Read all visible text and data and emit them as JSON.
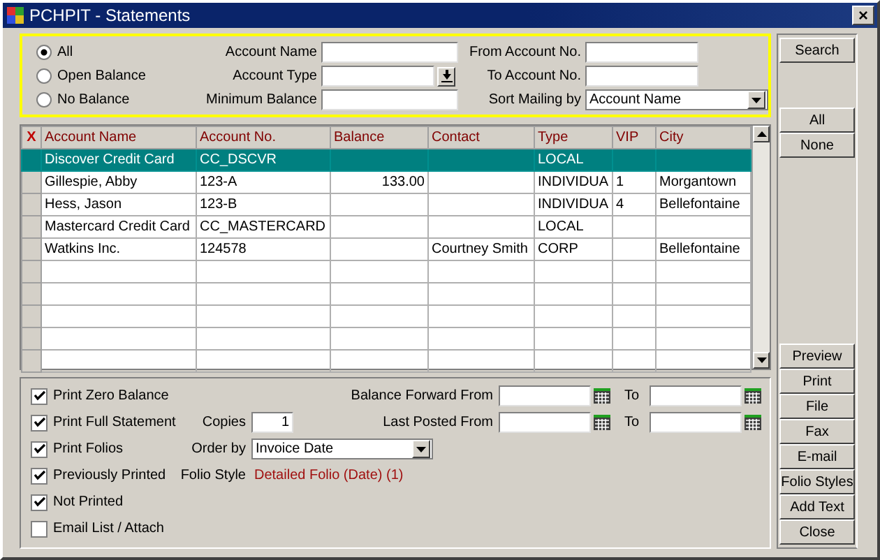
{
  "window": {
    "title": "PCHPIT - Statements",
    "close": "×"
  },
  "filter": {
    "radios": [
      {
        "label": "All",
        "selected": true
      },
      {
        "label": "Open Balance",
        "selected": false
      },
      {
        "label": "No Balance",
        "selected": false
      }
    ],
    "account_name": {
      "label": "Account Name"
    },
    "account_type": {
      "label": "Account Type"
    },
    "minimum_balance": {
      "label": "Minimum Balance"
    },
    "from_account": {
      "label": "From Account No."
    },
    "to_account": {
      "label": "To Account No."
    },
    "sort_mailing": {
      "label": "Sort Mailing by",
      "value": "Account Name"
    }
  },
  "table": {
    "marker": "X",
    "columns": [
      "Account Name",
      "Account No.",
      "Balance",
      "Contact",
      "Type",
      "VIP",
      "City"
    ],
    "rows": [
      {
        "selected": true,
        "cells": [
          "Discover Credit Card",
          "CC_DSCVR",
          null,
          null,
          "LOCAL",
          null,
          null
        ]
      },
      {
        "selected": false,
        "cells": [
          "Gillespie, Abby",
          "123-A",
          "133.00",
          null,
          "INDIVIDUA",
          "1",
          "Morgantown"
        ]
      },
      {
        "selected": false,
        "cells": [
          "Hess, Jason",
          "123-B",
          null,
          null,
          "INDIVIDUA",
          "4",
          "Bellefontaine"
        ]
      },
      {
        "selected": false,
        "cells": [
          "Mastercard Credit Card",
          "CC_MASTERCARD",
          null,
          null,
          "LOCAL",
          null,
          null
        ]
      },
      {
        "selected": false,
        "cells": [
          "Watkins Inc.",
          "124578",
          null,
          "Courtney Smith",
          "CORP",
          null,
          "Bellefontaine"
        ]
      }
    ]
  },
  "options": {
    "checkboxes": [
      {
        "label": "Print Zero Balance",
        "checked": true
      },
      {
        "label": "Print Full Statement",
        "checked": true
      },
      {
        "label": "Print Folios",
        "checked": true
      },
      {
        "label": "Previously Printed",
        "checked": true
      },
      {
        "label": "Not Printed",
        "checked": true
      },
      {
        "label": "Email List / Attach",
        "checked": false
      }
    ],
    "copies": {
      "label": "Copies",
      "value": "1"
    },
    "order_by": {
      "label": "Order by",
      "value": "Invoice Date"
    },
    "folio_style": {
      "label": "Folio Style",
      "value": "Detailed Folio (Date) (1)"
    },
    "date_ranges": [
      {
        "label": "Balance Forward From",
        "to_label": "To"
      },
      {
        "label": "Last Posted From",
        "to_label": "To"
      }
    ]
  },
  "side_buttons": {
    "top": [
      "Search"
    ],
    "select": [
      "All",
      "None"
    ],
    "actions": [
      "Preview",
      "Print",
      "File",
      "Fax",
      "E-mail",
      "Folio Styles",
      "Add Text",
      "Close"
    ]
  }
}
